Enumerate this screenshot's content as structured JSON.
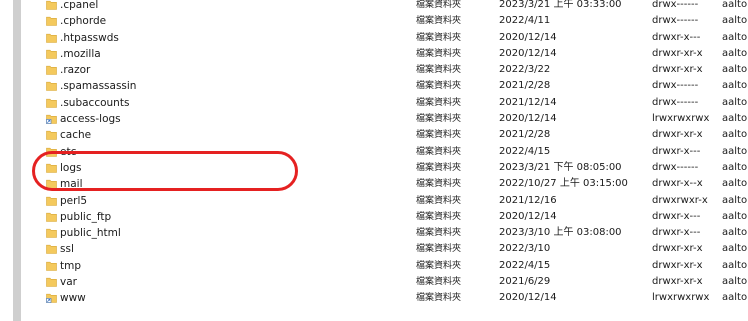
{
  "colors": {
    "folder": "#f4c95d",
    "annotation": "#e52121"
  },
  "icons": {
    "folder": "folder-icon",
    "symlink": "symlink-folder-icon"
  },
  "files": [
    {
      "name": ".cpanel",
      "type": "檔案資料夾",
      "modified": "2023/3/21 上午 03:33:00",
      "permissions": "drwx------",
      "owner": "aalto",
      "icon": "folder"
    },
    {
      "name": ".cphorde",
      "type": "檔案資料夾",
      "modified": "2022/4/11",
      "permissions": "drwx------",
      "owner": "aalto",
      "icon": "folder"
    },
    {
      "name": ".htpasswds",
      "type": "檔案資料夾",
      "modified": "2020/12/14",
      "permissions": "drwxr-x---",
      "owner": "aalto",
      "icon": "folder"
    },
    {
      "name": ".mozilla",
      "type": "檔案資料夾",
      "modified": "2020/12/14",
      "permissions": "drwxr-xr-x",
      "owner": "aalto",
      "icon": "folder"
    },
    {
      "name": ".razor",
      "type": "檔案資料夾",
      "modified": "2022/3/22",
      "permissions": "drwxr-xr-x",
      "owner": "aalto",
      "icon": "folder"
    },
    {
      "name": ".spamassassin",
      "type": "檔案資料夾",
      "modified": "2021/2/28",
      "permissions": "drwx------",
      "owner": "aalto",
      "icon": "folder"
    },
    {
      "name": ".subaccounts",
      "type": "檔案資料夾",
      "modified": "2021/12/14",
      "permissions": "drwx------",
      "owner": "aalto",
      "icon": "folder"
    },
    {
      "name": "access-logs",
      "type": "檔案資料夾",
      "modified": "2020/12/14",
      "permissions": "lrwxrwxrwx",
      "owner": "aalto",
      "icon": "symlink"
    },
    {
      "name": "cache",
      "type": "檔案資料夾",
      "modified": "2021/2/28",
      "permissions": "drwxr-xr-x",
      "owner": "aalto",
      "icon": "folder"
    },
    {
      "name": "etc",
      "type": "檔案資料夾",
      "modified": "2022/4/15",
      "permissions": "drwxr-x---",
      "owner": "aalto",
      "icon": "folder"
    },
    {
      "name": "logs",
      "type": "檔案資料夾",
      "modified": "2023/3/21 下午 08:05:00",
      "permissions": "drwx------",
      "owner": "aalto",
      "icon": "folder"
    },
    {
      "name": "mail",
      "type": "檔案資料夾",
      "modified": "2022/10/27 上午 03:15:00",
      "permissions": "drwxr-x--x",
      "owner": "aalto",
      "icon": "folder"
    },
    {
      "name": "perl5",
      "type": "檔案資料夾",
      "modified": "2021/12/16",
      "permissions": "drwxrwxr-x",
      "owner": "aalto",
      "icon": "folder"
    },
    {
      "name": "public_ftp",
      "type": "檔案資料夾",
      "modified": "2020/12/14",
      "permissions": "drwxr-x---",
      "owner": "aalto",
      "icon": "folder"
    },
    {
      "name": "public_html",
      "type": "檔案資料夾",
      "modified": "2023/3/10 上午 03:08:00",
      "permissions": "drwxr-x---",
      "owner": "aalto",
      "icon": "folder"
    },
    {
      "name": "ssl",
      "type": "檔案資料夾",
      "modified": "2022/3/10",
      "permissions": "drwxr-xr-x",
      "owner": "aalto",
      "icon": "folder"
    },
    {
      "name": "tmp",
      "type": "檔案資料夾",
      "modified": "2022/4/15",
      "permissions": "drwxr-xr-x",
      "owner": "aalto",
      "icon": "folder"
    },
    {
      "name": "var",
      "type": "檔案資料夾",
      "modified": "2021/6/29",
      "permissions": "drwxr-xr-x",
      "owner": "aalto",
      "icon": "folder"
    },
    {
      "name": "www",
      "type": "檔案資料夾",
      "modified": "2020/12/14",
      "permissions": "lrwxrwxrwx",
      "owner": "aalto",
      "icon": "symlink"
    }
  ]
}
